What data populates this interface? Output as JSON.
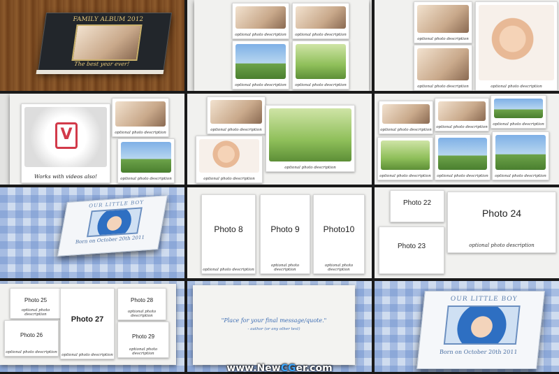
{
  "cells": {
    "c1": {
      "album_title": "FAMILY ALBUM 2012",
      "album_tagline": "The best year ever!"
    },
    "c2": {
      "captions": [
        "optional photo description",
        "optional photo description",
        "optional photo description",
        "optional photo description"
      ]
    },
    "c3": {
      "captions": [
        "optional photo description",
        "optional photo description",
        "optional photo description"
      ]
    },
    "c4": {
      "video_caption": "Works with videos also!",
      "captions": [
        "optional photo description",
        "optional photo description"
      ]
    },
    "c5": {
      "captions": [
        "optional photo description",
        "optional photo description",
        "optional photo description"
      ]
    },
    "c6": {
      "captions": [
        "optional photo description",
        "optional photo description",
        "optional photo description",
        "optional photo description",
        "optional photo description",
        "optional photo description"
      ]
    },
    "c7": {
      "book_title": "OUR LITTLE BOY",
      "book_date": "Born on October 20th 2011"
    },
    "c8": {
      "labels": [
        "Photo 8",
        "Photo 9",
        "Photo10"
      ],
      "captions": [
        "optional photo description",
        "optional photo description",
        "optional photo description"
      ]
    },
    "c9": {
      "labels": [
        "Photo 22",
        "Photo 23",
        "Photo 24"
      ],
      "caption": "optional photo description"
    },
    "c10": {
      "labels": [
        "Photo 25",
        "Photo 26",
        "Photo 27",
        "Photo 28",
        "Photo 29"
      ],
      "captions": [
        "optional photo description",
        "optional photo description",
        "optional photo description",
        "optional photo description",
        "optional photo description"
      ]
    },
    "c11": {
      "message": "\"Place for your final message/quote.\"",
      "author": "- author (or any other text)"
    },
    "c12": {
      "book_title": "OUR LITTLE BOY",
      "book_date": "Born on October 20th 2011"
    }
  },
  "watermark": {
    "prefix": "www.",
    "brand_a": "New",
    "brand_b": "CG",
    "brand_c": "er",
    "suffix": ".com"
  }
}
